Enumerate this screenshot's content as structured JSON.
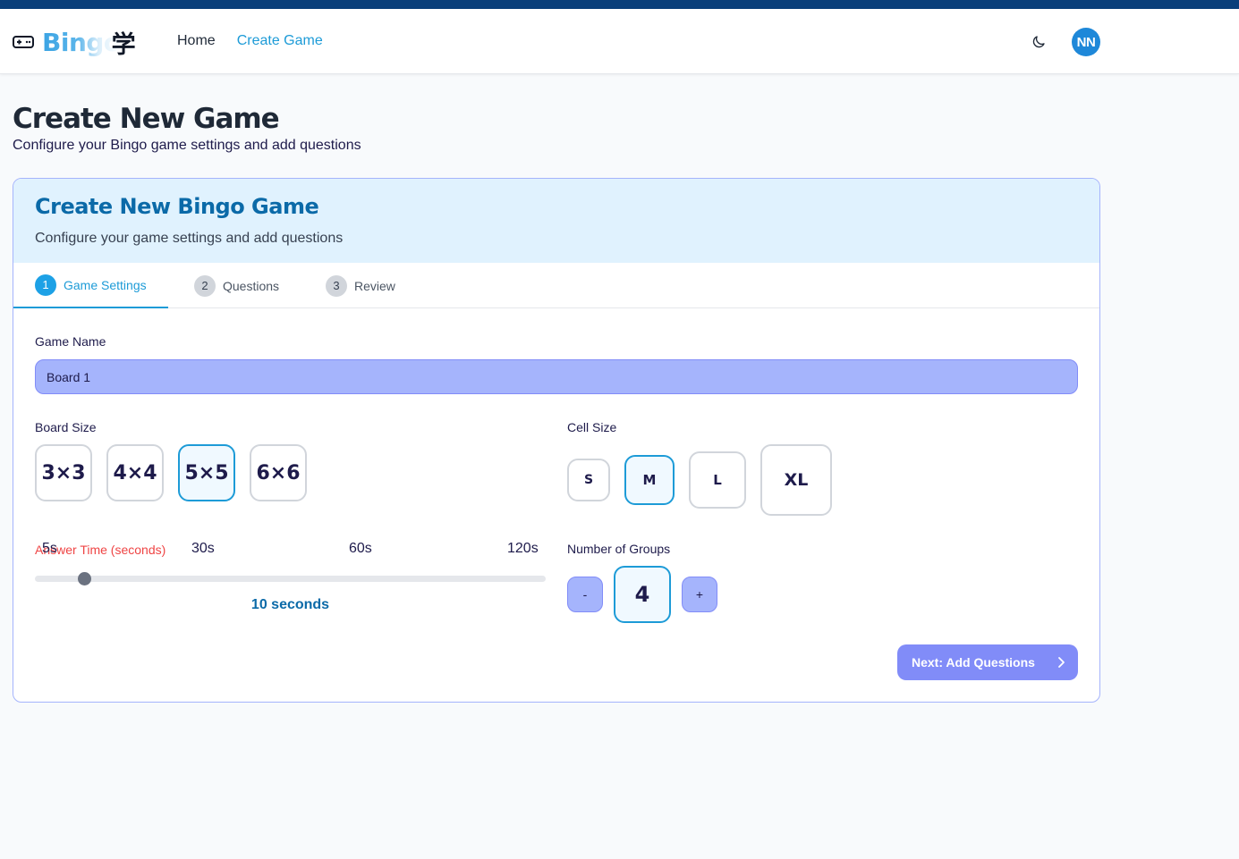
{
  "app": {
    "logo_text": "Bingo",
    "logo_kanji": "学",
    "nav": [
      {
        "label": "Home",
        "active": false
      },
      {
        "label": "Create Game",
        "active": true
      }
    ],
    "avatar_initials": "NN",
    "theme_icon": "moon-icon",
    "colors": {
      "accent": "#1d9bd7",
      "header_bar": "#0b3f7a",
      "avatar": "#1e88d9",
      "input_fill": "#a5b4fc",
      "button_fill": "#818cf8"
    }
  },
  "page": {
    "title": "Create New Game",
    "subtitle": "Configure your Bingo game settings and add questions"
  },
  "card": {
    "title": "Create New Bingo Game",
    "subtitle": "Configure your game settings and add questions",
    "tabs": [
      {
        "num": "1",
        "label": "Game Settings",
        "active": true
      },
      {
        "num": "2",
        "label": "Questions",
        "active": false
      },
      {
        "num": "3",
        "label": "Review",
        "active": false
      }
    ]
  },
  "form": {
    "game_name_label": "Game Name",
    "game_name_value": "Board 1",
    "board_size_label": "Board Size",
    "board_sizes": [
      "3×3",
      "4×4",
      "5×5",
      "6×6"
    ],
    "board_size_selected": "5×5",
    "cell_size_label": "Cell Size",
    "cell_sizes": [
      "S",
      "M",
      "L",
      "XL"
    ],
    "cell_size_selected": "M",
    "answer_time_label": "Answer Time (seconds)",
    "answer_time_ticks": [
      "5s",
      "30s",
      "60s",
      "120s"
    ],
    "answer_time_min": 5,
    "answer_time_max": 120,
    "answer_time_value": 10,
    "answer_time_display": "10 seconds",
    "groups_label": "Number of Groups",
    "groups_minus": "-",
    "groups_plus": "+",
    "groups_value": "4",
    "next_button": "Next: Add Questions"
  }
}
